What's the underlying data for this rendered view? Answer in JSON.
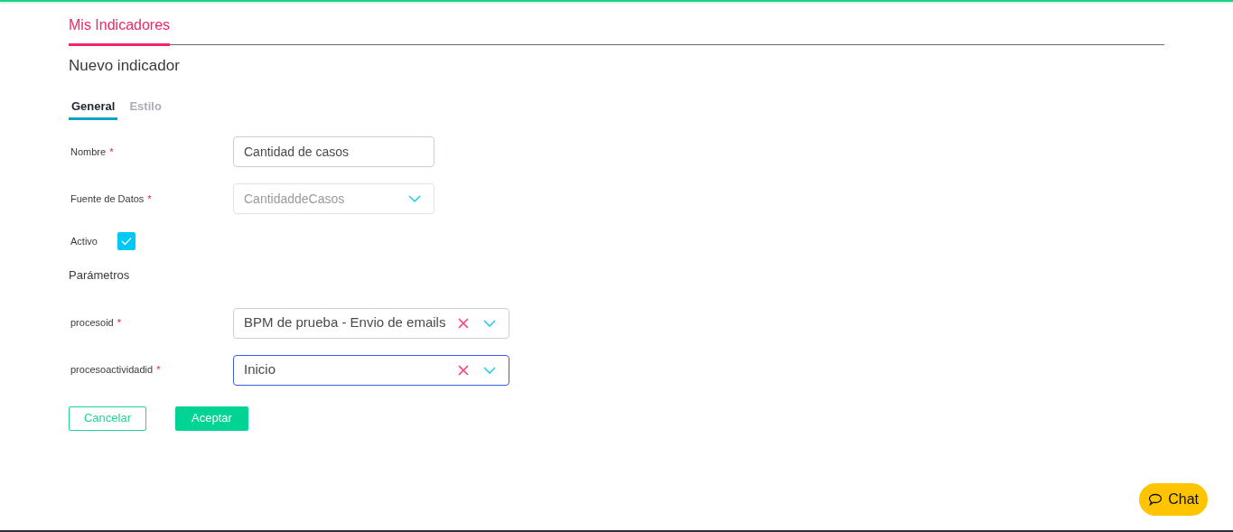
{
  "page_tabs": [
    {
      "label": "Mis Indicadores",
      "selected": true
    }
  ],
  "heading": "Nuevo indicador",
  "required_mark": "*",
  "form_tabs": [
    {
      "label": "General",
      "selected": true
    },
    {
      "label": "Estilo",
      "selected": false
    }
  ],
  "fields": [
    {
      "kind": "text",
      "label": "Nombre",
      "required": true,
      "value": "Cantidad de casos",
      "disabled": false
    },
    {
      "kind": "select",
      "label": "Fuente de Datos",
      "required": true,
      "value": "CantidaddeCasos",
      "disabled": true,
      "focused": false
    },
    {
      "kind": "checkbox",
      "label": "Activo",
      "checked": true
    }
  ],
  "parameters_title": "Parámetros",
  "parameters": [
    {
      "kind": "select",
      "label": "procesoid",
      "required": true,
      "value": "BPM de prueba - Envio de emails",
      "disabled": false,
      "clearable": true,
      "focused": false
    },
    {
      "kind": "select",
      "label": "procesoactividadid",
      "required": true,
      "value": "Inicio",
      "disabled": false,
      "clearable": true,
      "focused": true
    }
  ],
  "buttons": [
    {
      "kind": "outline",
      "label": "Cancelar"
    },
    {
      "kind": "primary",
      "label": "Aceptar"
    }
  ],
  "chat": {
    "label": "Chat"
  }
}
